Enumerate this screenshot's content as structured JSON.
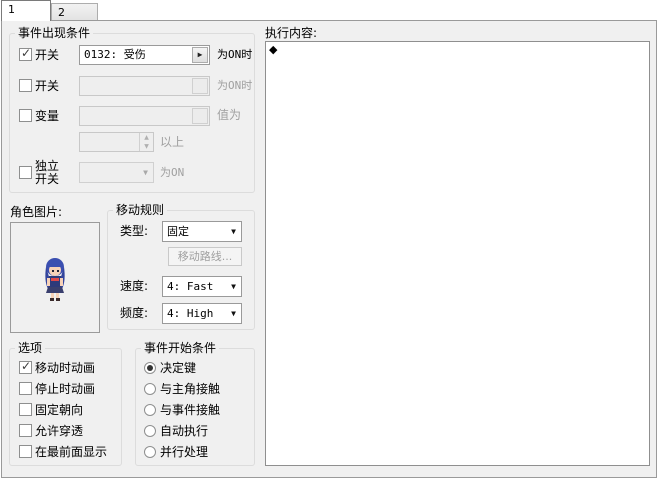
{
  "tabs": [
    {
      "label": "1",
      "active": true
    },
    {
      "label": "2",
      "active": false
    }
  ],
  "conditions": {
    "title": "事件出现条件",
    "switch1": {
      "label": "开关",
      "checked": true,
      "value": "0132: 受伤",
      "suffix": "为ON时"
    },
    "switch2": {
      "label": "开关",
      "checked": false,
      "value": "",
      "suffix": "为ON时"
    },
    "variable": {
      "label": "变量",
      "checked": false,
      "value": "",
      "suffix": "值为",
      "amount": "",
      "amount_suffix": "以上"
    },
    "self_switch": {
      "label_line1": "独立",
      "label_line2": "开关",
      "checked": false,
      "value": "",
      "suffix": "为ON"
    }
  },
  "graphic": {
    "title": "角色图片:",
    "description": "small sprite of a blue-haired girl facing down"
  },
  "movement": {
    "title": "移动规则",
    "type_label": "类型:",
    "type_value": "固定",
    "route_button": "移动路线...",
    "speed_label": "速度:",
    "speed_value": "4: Fast",
    "freq_label": "频度:",
    "freq_value": "4: High"
  },
  "options": {
    "title": "选项",
    "items": [
      {
        "label": "移动时动画",
        "checked": true
      },
      {
        "label": "停止时动画",
        "checked": false
      },
      {
        "label": "固定朝向",
        "checked": false
      },
      {
        "label": "允许穿透",
        "checked": false
      },
      {
        "label": "在最前面显示",
        "checked": false
      }
    ]
  },
  "trigger": {
    "title": "事件开始条件",
    "items": [
      {
        "label": "决定键",
        "selected": true
      },
      {
        "label": "与主角接触",
        "selected": false
      },
      {
        "label": "与事件接触",
        "selected": false
      },
      {
        "label": "自动执行",
        "selected": false
      },
      {
        "label": "并行处理",
        "selected": false
      }
    ]
  },
  "contents": {
    "title": "执行内容:",
    "first_line": "◆"
  },
  "icons": {
    "checkbox_tick": "check-icon",
    "ellipsis": "ellipsis-icon",
    "dropdown": "chevron-down-icon"
  }
}
